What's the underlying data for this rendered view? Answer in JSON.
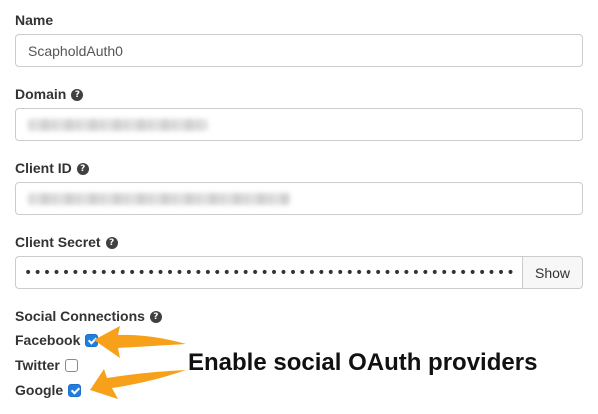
{
  "form": {
    "name": {
      "label": "Name",
      "value": "ScapholdAuth0"
    },
    "domain": {
      "label": "Domain",
      "help_icon": "question-circle-icon",
      "value_blurred": true
    },
    "client_id": {
      "label": "Client ID",
      "help_icon": "question-circle-icon",
      "value_blurred": true
    },
    "client_secret": {
      "label": "Client Secret",
      "help_icon": "question-circle-icon",
      "masked_value": "••••••••••••••••••••••••••••••••••••••••••••••••••••••••••••",
      "show_label": "Show"
    },
    "social_connections": {
      "label": "Social Connections",
      "help_icon": "question-circle-icon",
      "providers": [
        {
          "label": "Facebook",
          "checked": true
        },
        {
          "label": "Twitter",
          "checked": false
        },
        {
          "label": "Google",
          "checked": true
        }
      ]
    }
  },
  "annotation": {
    "text": "Enable social OAuth providers",
    "arrow_color": "#f7a11a"
  },
  "colors": {
    "checkbox_checked": "#1f7fe0",
    "input_border": "#cccccc",
    "label_text": "#333333"
  }
}
